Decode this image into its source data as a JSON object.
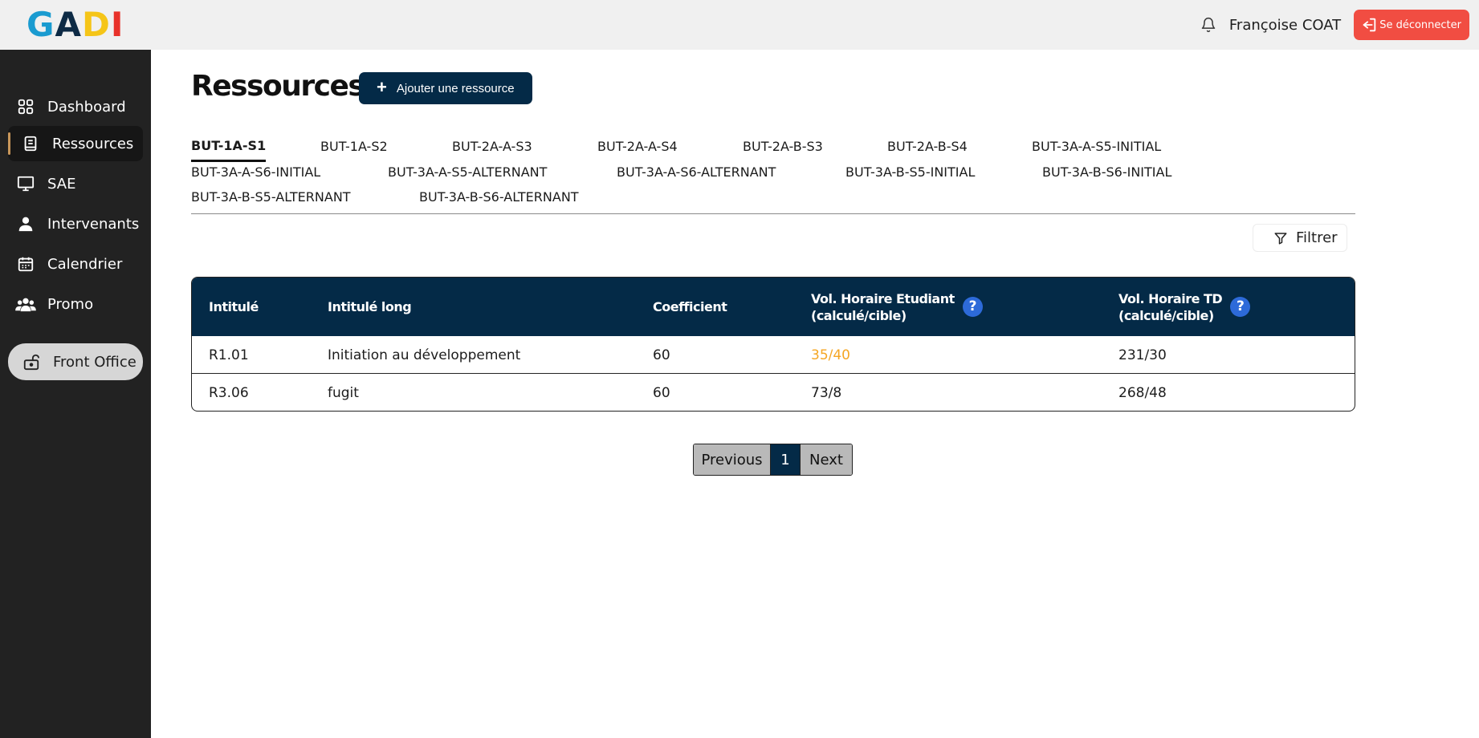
{
  "app": {
    "logo_letters": [
      {
        "char": "G",
        "color": "#1a9bd0"
      },
      {
        "char": "A",
        "color": "#0d2a45"
      },
      {
        "char": "D",
        "color": "#f5c518"
      },
      {
        "char": "I",
        "color": "#e8312a"
      }
    ]
  },
  "header": {
    "user_name": "Françoise COAT",
    "logout_label": "Se déconnecter",
    "bell_icon": "bell-icon"
  },
  "sidebar": {
    "items": [
      {
        "label": "Dashboard",
        "icon": "dashboard-grid-icon"
      },
      {
        "label": "Ressources",
        "icon": "book-icon",
        "active": true
      },
      {
        "label": "SAE",
        "icon": "monitor-icon"
      },
      {
        "label": "Intervenants",
        "icon": "user-icon"
      },
      {
        "label": "Calendrier",
        "icon": "calendar-icon"
      },
      {
        "label": "Promo",
        "icon": "group-icon"
      }
    ],
    "front_office_label": "Front Office"
  },
  "main": {
    "title": "Ressources",
    "add_button_label": "Ajouter une ressource",
    "filter_label": "Filtrer",
    "tabs": [
      "BUT-1A-S1",
      "BUT-1A-S2",
      "BUT-2A-A-S3",
      "BUT-2A-A-S4",
      "BUT-2A-B-S3",
      "BUT-2A-B-S4",
      "BUT-3A-A-S5-INITIAL",
      "BUT-3A-A-S6-INITIAL",
      "BUT-3A-A-S5-ALTERNANT",
      "BUT-3A-A-S6-ALTERNANT",
      "BUT-3A-B-S5-INITIAL",
      "BUT-3A-B-S6-INITIAL",
      "BUT-3A-B-S5-ALTERNANT",
      "BUT-3A-B-S6-ALTERNANT"
    ],
    "active_tab": "BUT-1A-S1",
    "table": {
      "headers": {
        "intitule": "Intitulé",
        "intitule_long": "Intitulé long",
        "coefficient": "Coefficient",
        "vol_etudiant_line1": "Vol. Horaire Etudiant",
        "vol_etudiant_line2": "(calculé/cible)",
        "vol_td_line1": "Vol. Horaire TD",
        "vol_td_line2": "(calculé/cible)",
        "help_glyph": "?"
      },
      "rows": [
        {
          "intitule": "R1.01",
          "intitule_long": "Initiation au développement",
          "coefficient": "60",
          "vol_etudiant": "35/40",
          "vol_td": "231/30"
        },
        {
          "intitule": "R3.06",
          "intitule_long": "fugit",
          "coefficient": "60",
          "vol_etudiant": "73/8",
          "vol_td": "268/48"
        }
      ],
      "warning_color": "#f5a623"
    },
    "pagination": {
      "previous_label": "Previous",
      "current_page": "1",
      "next_label": "Next"
    }
  }
}
